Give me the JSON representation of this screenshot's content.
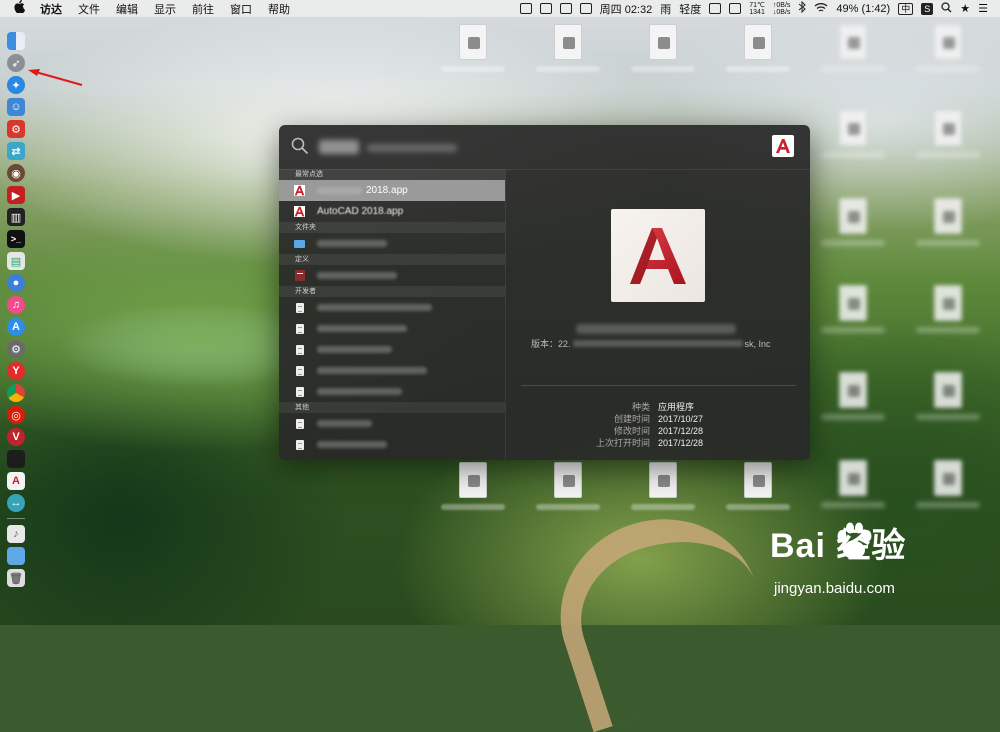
{
  "menubar": {
    "app_name": "访达",
    "items": [
      "文件",
      "编辑",
      "显示",
      "前往",
      "窗口",
      "帮助"
    ],
    "status": {
      "datetime": "周四 02:32",
      "weather": "雨",
      "air": "轻度",
      "temp": "71℃",
      "fan": "1341",
      "net_up": "↑0B/s",
      "net_down": "↓0B/s",
      "battery": "49% (1:42)",
      "input_method": "中"
    }
  },
  "spotlight": {
    "sections": {
      "top_hits": "最常点选",
      "folders": "文件夹",
      "definition": "定义",
      "developer": "开发者",
      "other": "其他"
    },
    "top_hits": [
      {
        "label": "2018.app",
        "icon": "autocad-icon"
      },
      {
        "label": "AutoCAD 2018.app",
        "icon": "autocad-icon"
      }
    ],
    "preview": {
      "version_label": "版本：22.",
      "version_suffix": "sk, Inc",
      "meta": [
        {
          "key": "种类",
          "value": "应用程序"
        },
        {
          "key": "创建时间",
          "value": "2017/10/27"
        },
        {
          "key": "修改时间",
          "value": "2017/12/28"
        },
        {
          "key": "上次打开时间",
          "value": "2017/12/28"
        }
      ]
    }
  },
  "watermark": {
    "brand": "Bai  经验",
    "url": "jingyan.baidu.com"
  }
}
